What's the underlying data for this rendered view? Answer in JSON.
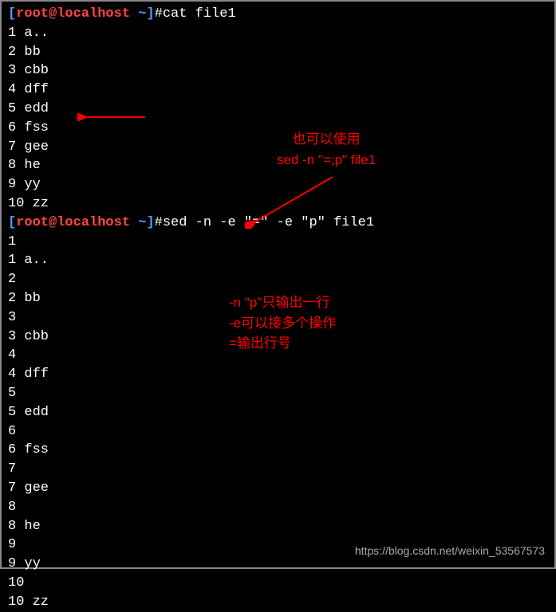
{
  "prompt": {
    "bracket_open": "[",
    "user_host": "root@localhost",
    "tilde": " ~",
    "bracket_close": "]",
    "hash": "#"
  },
  "command1": "cat file1",
  "output1": [
    "1 a..",
    "2 bb",
    "3 cbb",
    "4 dff",
    "5 edd",
    "6 fss",
    "7 gee",
    "8 he",
    "9 yy",
    "10 zz"
  ],
  "command2": "sed -n -e \"=\" -e \"p\" file1",
  "output2": [
    "1",
    "1 a..",
    "2",
    "2 bb",
    "3",
    "3 cbb",
    "4",
    "4 dff",
    "5",
    "5 edd",
    "6",
    "6 fss",
    "7",
    "7 gee",
    "8",
    "8 he",
    "9",
    "9 yy",
    "10",
    "10 zz"
  ],
  "annotation1": {
    "line1": "也可以使用",
    "line2": "sed -n \"=;p\" file1"
  },
  "annotation2": {
    "line1": "-n \"p\"只输出一行",
    "line2": "-e可以接多个操作",
    "line3": "=输出行号"
  },
  "watermark": "https://blog.csdn.net/weixin_53567573"
}
